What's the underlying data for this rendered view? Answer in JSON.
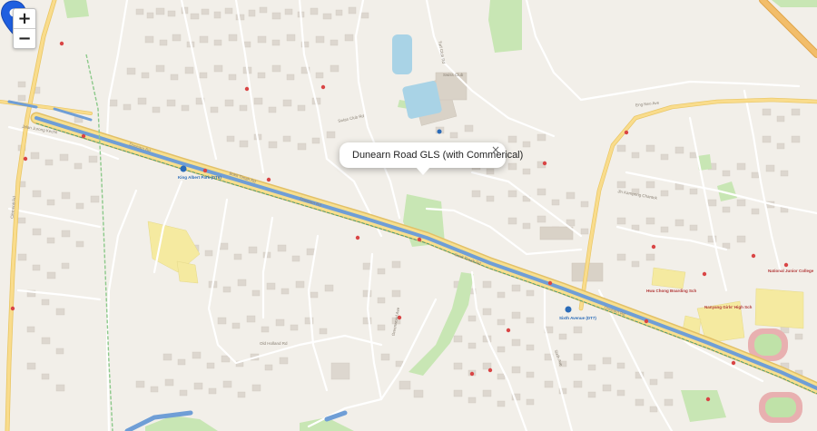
{
  "map": {
    "zoom_in_label": "+",
    "zoom_out_label": "−"
  },
  "popup": {
    "text": "Dunearn Road GLS (with Commerical)",
    "close_label": "×"
  },
  "labels": {
    "dunearn_rd": "Dunearn Rd",
    "bukit_timah_rd": "Bukit Timah Rd",
    "king_albert_park": "King Albert Park (DT6)",
    "sixth_avenue": "Sixth Avenue (DT7)",
    "swiss_club_rd": "Swiss Club Rd",
    "turf_club_rd": "Turf Club Rd",
    "old_holland_rd": "Old Holland Rd",
    "sixth_ave": "Sixth Ave",
    "jalan_kampong_chantek": "Jln Kampong Chantek",
    "national_jc": "National Junior College",
    "eng_neo_ave": "Eng Neo Ave",
    "jalan_jurong_kechil": "Jalan Jurong Kechil",
    "clementi_rd": "Clementi Rd",
    "greenwood_ave": "Greenwood Ave",
    "swiss_club": "Swiss Club",
    "nanyang_girls": "Nanyang Girls' High Sch",
    "hwa_chong": "Hwa Chong Boarding Sch"
  }
}
